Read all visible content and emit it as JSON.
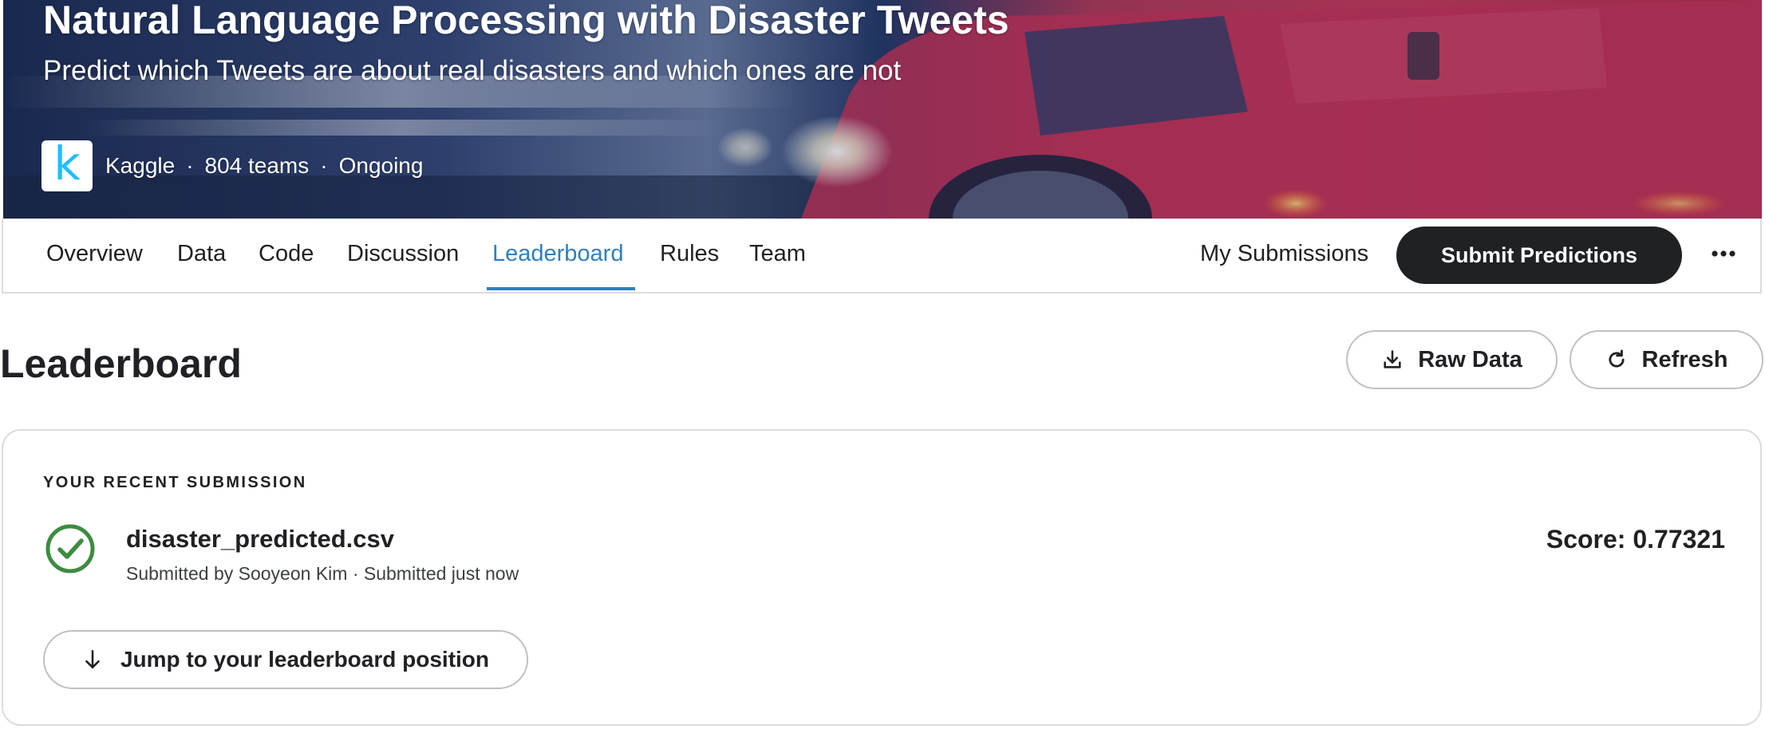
{
  "competition": {
    "title": "Natural Language Processing with Disaster Tweets",
    "subtitle": "Predict which Tweets are about real disasters and which ones are not",
    "host": "Kaggle",
    "teams": "804 teams",
    "status": "Ongoing",
    "logo_letter": "k",
    "separator": "·"
  },
  "tabs": [
    {
      "label": "Overview",
      "active": false
    },
    {
      "label": "Data",
      "active": false
    },
    {
      "label": "Code",
      "active": false
    },
    {
      "label": "Discussion",
      "active": false
    },
    {
      "label": "Leaderboard",
      "active": true
    },
    {
      "label": "Rules",
      "active": false
    },
    {
      "label": "Team",
      "active": false
    }
  ],
  "actions": {
    "my_submissions": "My Submissions",
    "submit_predictions": "Submit Predictions",
    "more": "•••"
  },
  "leaderboard": {
    "title": "Leaderboard",
    "raw_data_label": "Raw Data",
    "refresh_label": "Refresh"
  },
  "recent_submission": {
    "section_label": "YOUR RECENT SUBMISSION",
    "file_name": "disaster_predicted.csv",
    "submitted_by": "Submitted by Sooyeon Kim · Submitted just now",
    "score": "Score: 0.77321",
    "status": "success",
    "jump_label": "Jump to your leaderboard position"
  },
  "icons": {
    "logo": "kaggle-logo",
    "download": "download-icon",
    "refresh": "refresh-icon",
    "check": "check-circle-icon",
    "arrow_down": "arrow-down-icon",
    "more": "more-horizontal-icon"
  },
  "colors": {
    "accent_blue": "#2f7fc1",
    "primary_button": "#202124",
    "success_green": "#3d8b40",
    "kaggle_blue": "#20beff",
    "border": "#dadce0"
  }
}
